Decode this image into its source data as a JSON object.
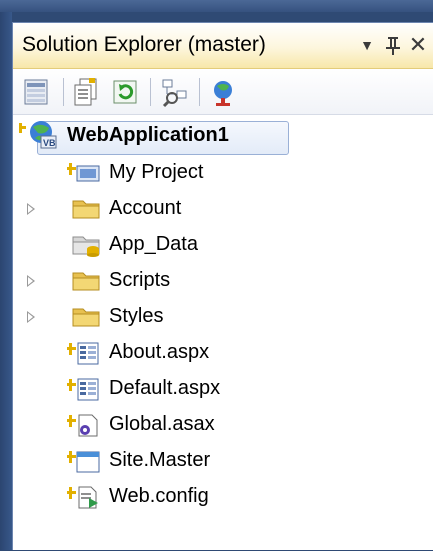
{
  "window": {
    "title": "Solution Explorer (master)",
    "dropdown_glyph": "▼",
    "pin_glyph": "ᅲ",
    "close_glyph": "✕"
  },
  "toolbar": {
    "buttons": [
      {
        "name": "properties-icon"
      },
      {
        "name": "show-all-files-icon"
      },
      {
        "name": "refresh-icon"
      },
      {
        "name": "view-class-diagram-icon"
      },
      {
        "name": "copy-website-icon"
      }
    ]
  },
  "tree": {
    "root": {
      "label": "WebApplication1",
      "icon": "web-project-icon",
      "selected": true
    },
    "items": [
      {
        "label": "My Project",
        "icon": "my-project-icon",
        "expandable": false
      },
      {
        "label": "Account",
        "icon": "folder-icon",
        "expandable": true
      },
      {
        "label": "App_Data",
        "icon": "app-data-folder-icon",
        "expandable": false
      },
      {
        "label": "Scripts",
        "icon": "folder-icon",
        "expandable": true
      },
      {
        "label": "Styles",
        "icon": "folder-icon",
        "expandable": true
      },
      {
        "label": "About.aspx",
        "icon": "aspx-file-icon",
        "expandable": false
      },
      {
        "label": "Default.aspx",
        "icon": "aspx-file-icon",
        "expandable": false
      },
      {
        "label": "Global.asax",
        "icon": "asax-file-icon",
        "expandable": false
      },
      {
        "label": "Site.Master",
        "icon": "master-page-icon",
        "expandable": false
      },
      {
        "label": "Web.config",
        "icon": "config-file-icon",
        "expandable": false
      }
    ]
  },
  "colors": {
    "titlebar_gradient_end": "#f7e7a9",
    "folder": "#e8c150",
    "plus_marker": "#e2b000",
    "background_frame": "#2f4a74"
  }
}
